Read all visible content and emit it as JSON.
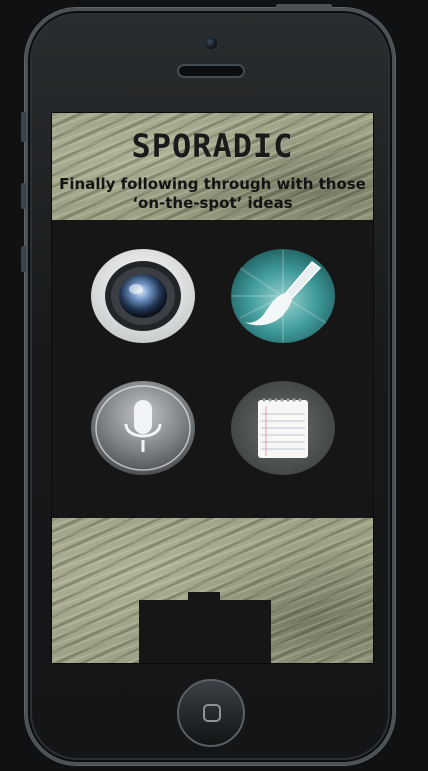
{
  "app": {
    "title": "SPORADIC",
    "tagline_line1": "Finally following through with those",
    "tagline_line2": "‘on-the-spot’ ideas"
  },
  "apps": [
    {
      "icon": "camera-lens-icon"
    },
    {
      "icon": "paintbrush-icon"
    },
    {
      "icon": "microphone-icon"
    },
    {
      "icon": "notepad-icon"
    }
  ],
  "colors": {
    "screen_background": "#161616",
    "texture": "#9ea286",
    "teal_icon": "#3f9a9a",
    "title_text": "#1a1a1a"
  }
}
